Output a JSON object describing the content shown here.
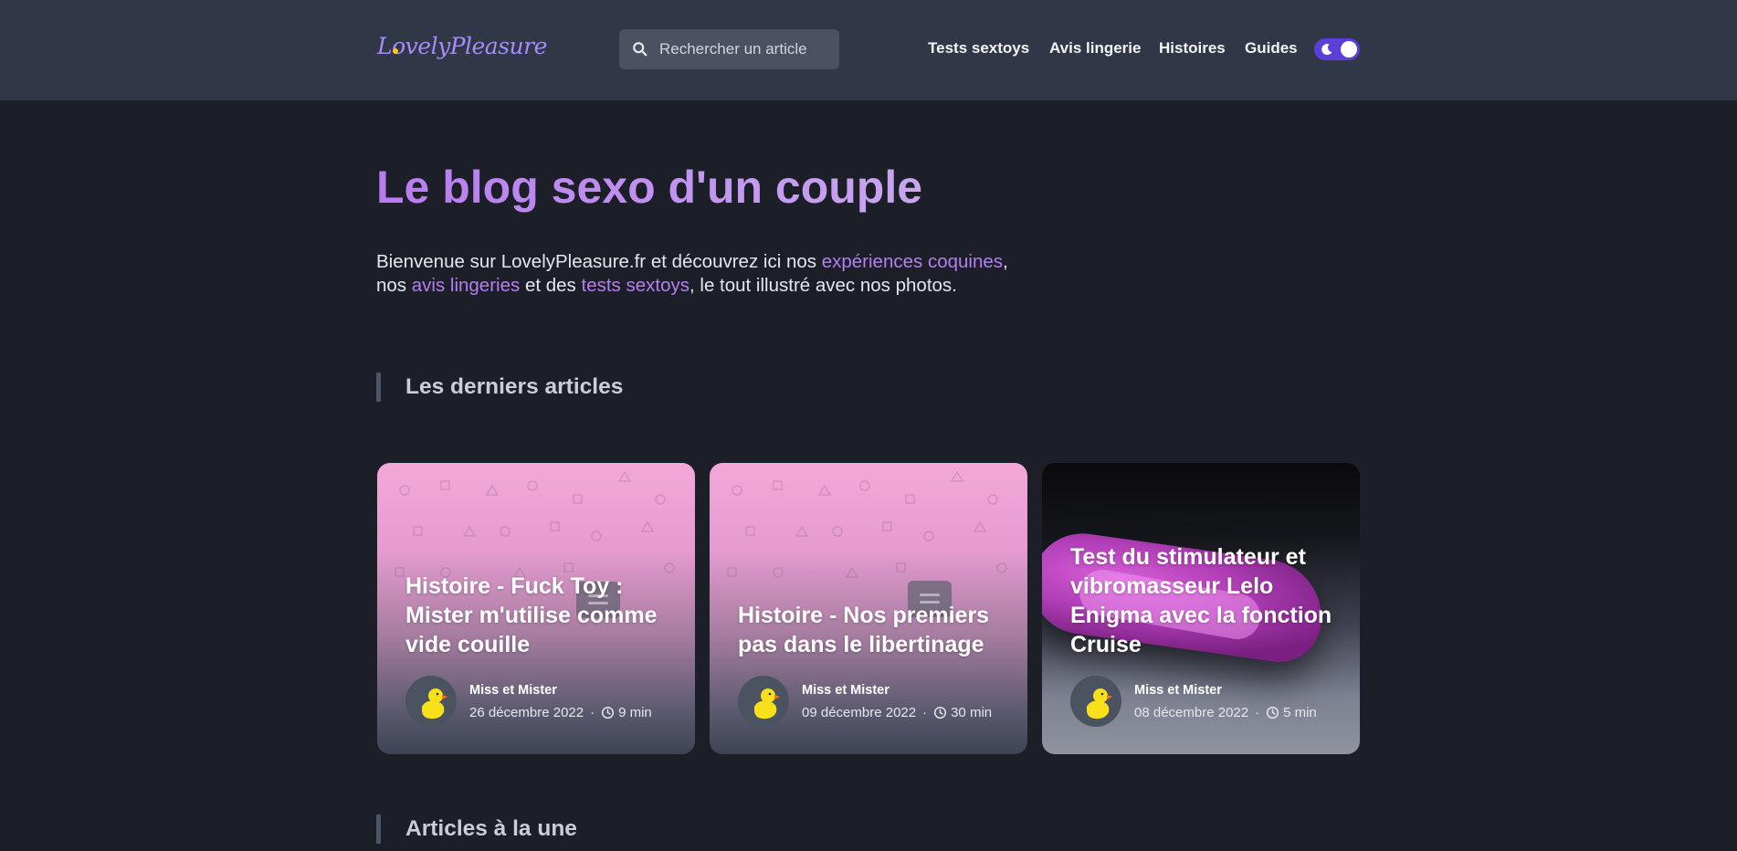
{
  "header": {
    "logo": "LovelyPleasure",
    "search_placeholder": "Rechercher un article",
    "nav": [
      "Tests sextoys",
      "Avis lingerie",
      "Histoires",
      "Guides"
    ],
    "theme_toggle_state": "dark"
  },
  "hero": {
    "title": "Le blog sexo d'un couple",
    "intro_1": "Bienvenue sur LovelyPleasure.fr et découvrez ici nos ",
    "intro_link_1": "expériences coquines",
    "intro_2": ",",
    "intro_3": "nos ",
    "intro_link_2": "avis lingeries",
    "intro_4": " et des ",
    "intro_link_3": "tests sextoys",
    "intro_5": ", le tout illustré avec nos photos."
  },
  "sections": {
    "latest": "Les derniers articles",
    "featured": "Articles à la une"
  },
  "articles": [
    {
      "title": "Histoire - Fuck Toy : Mister m'utilise comme vide couille",
      "author": "Miss et Mister",
      "date": "26 décembre 2022",
      "read_time": "9 min",
      "image": "pink-pattern"
    },
    {
      "title": "Histoire - Nos premiers pas dans le libertinage",
      "author": "Miss et Mister",
      "date": "09 décembre 2022",
      "read_time": "30 min",
      "image": "pink-pattern"
    },
    {
      "title": "Test du stimulateur et vibromasseur Lelo Enigma avec la fonction Cruise",
      "author": "Miss et Mister",
      "date": "08 décembre 2022",
      "read_time": "5 min",
      "image": "product-photo"
    }
  ],
  "colors": {
    "background": "#1c1f28",
    "header": "#303747",
    "accent": "#b57ff0",
    "toggle": "#5b3fd8"
  }
}
